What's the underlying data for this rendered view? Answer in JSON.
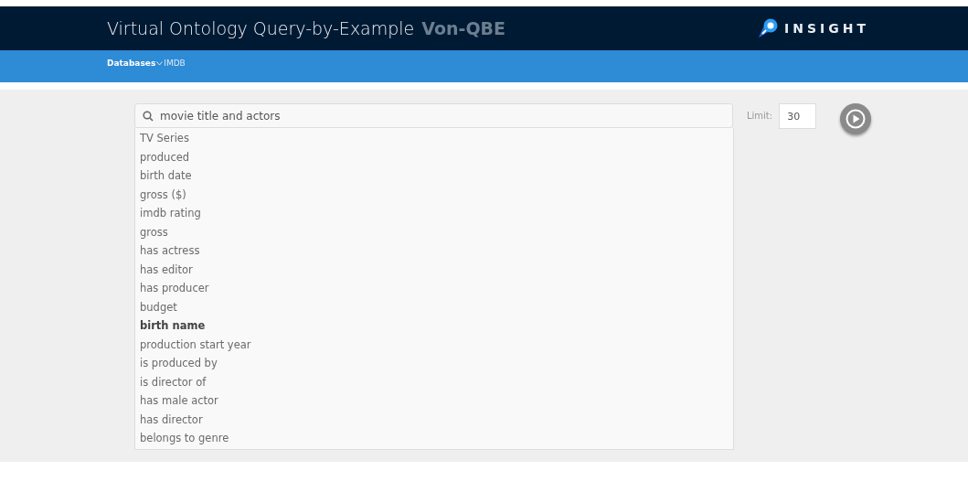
{
  "header": {
    "title": "Virtual Ontology Query-by-Example",
    "app_name": "Von-QBE",
    "logo_text": "INSIGHT"
  },
  "breadcrumb": {
    "menu": "Databases",
    "current": "IMDB"
  },
  "search": {
    "value": "movie title and actors"
  },
  "limit": {
    "label": "Limit:",
    "value": "30"
  },
  "suggestions": [
    {
      "label": "TV Series",
      "selected": false
    },
    {
      "label": "produced",
      "selected": false
    },
    {
      "label": "birth date",
      "selected": false
    },
    {
      "label": "gross ($)",
      "selected": false
    },
    {
      "label": "imdb rating",
      "selected": false
    },
    {
      "label": "gross",
      "selected": false
    },
    {
      "label": "has actress",
      "selected": false
    },
    {
      "label": "has editor",
      "selected": false
    },
    {
      "label": "has producer",
      "selected": false
    },
    {
      "label": "budget",
      "selected": false
    },
    {
      "label": "birth name",
      "selected": true
    },
    {
      "label": "production start year",
      "selected": false
    },
    {
      "label": "is produced by",
      "selected": false
    },
    {
      "label": "is director of",
      "selected": false
    },
    {
      "label": "has male actor",
      "selected": false
    },
    {
      "label": "has director",
      "selected": false
    },
    {
      "label": "belongs to genre",
      "selected": false
    }
  ]
}
